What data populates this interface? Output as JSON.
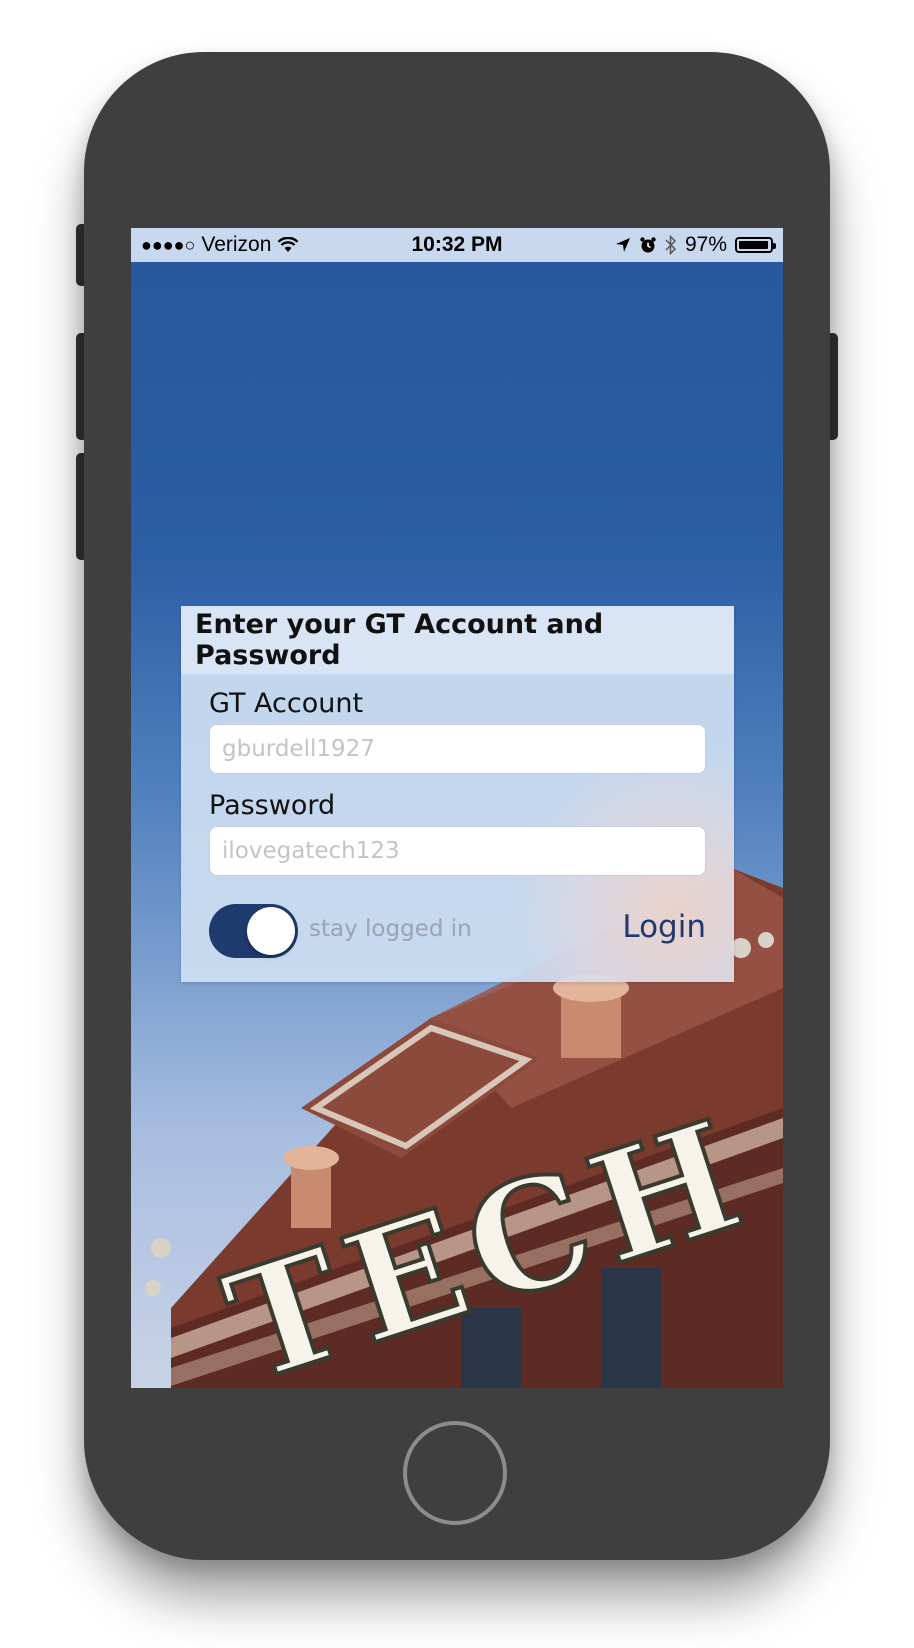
{
  "status_bar": {
    "signal": "●●●●○",
    "carrier": "Verizon",
    "wifi_icon": "wifi-icon",
    "time": "10:32 PM",
    "battery_percent": "97%",
    "battery_level": 0.97
  },
  "background": {
    "sign_text": "TECH"
  },
  "login_card": {
    "title": "Enter your GT Account and Password",
    "account_label": "GT Account",
    "account_placeholder": "gburdell1927",
    "password_label": "Password",
    "password_placeholder": "ilovegatech123",
    "stay_logged_in_label": "stay logged in",
    "stay_logged_in_on": true,
    "login_label": "Login"
  },
  "colors": {
    "accent": "#1f3a6d",
    "status_bar_bg": "#c8d9ef",
    "card_bg": "#cddef2",
    "phone_body": "#3f3f3f"
  }
}
